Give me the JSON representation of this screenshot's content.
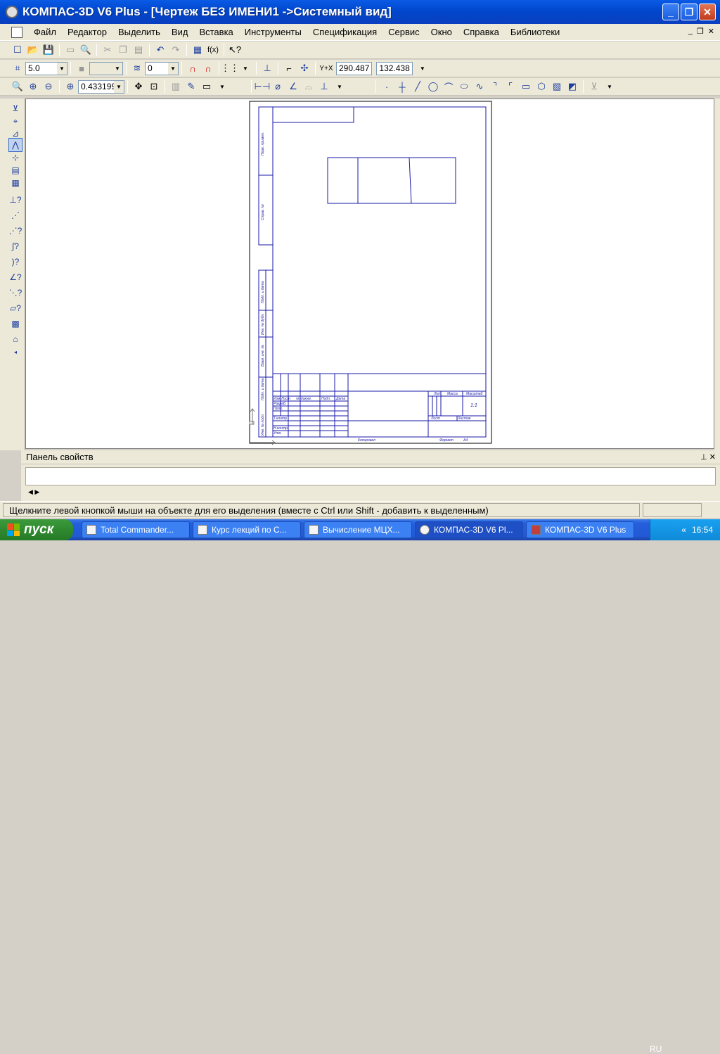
{
  "window": {
    "title": "КОМПАС-3D V6 Plus - [Чертеж БЕЗ ИМЕНИ1 ->Системный вид]"
  },
  "menu": [
    "Файл",
    "Редактор",
    "Выделить",
    "Вид",
    "Вставка",
    "Инструменты",
    "Спецификация",
    "Сервис",
    "Окно",
    "Справка",
    "Библиотеки"
  ],
  "toolbar": {
    "step_value": "5.0",
    "layer_value": "0",
    "coord_x": "290.487",
    "coord_y": "132.438",
    "zoom_value": "0.433199"
  },
  "drawing": {
    "margin_labels": [
      "Перв. примен.",
      "Справ. №",
      "Подп. и дата",
      "Инв. № дубл.",
      "Взам. инв. №",
      "Подп. и дата",
      "Инв. № подл."
    ],
    "titleblock": {
      "change_headers": [
        "Изм.",
        "Лист",
        "№ докум.",
        "Подп.",
        "Дата"
      ],
      "roles": [
        "Разраб.",
        "Пров.",
        "Т.контр.",
        "Н.контр.",
        "Утв."
      ],
      "lit": "Лит.",
      "mass": "Масса",
      "scale": "Масштаб",
      "scale_value": "1:1",
      "sheet": "Лист",
      "sheets": "Листов",
      "copied": "Копировал",
      "format": "Формат",
      "format_value": "A4"
    }
  },
  "properties_panel": {
    "title": "Панель свойств"
  },
  "status": {
    "message": "Щелкните левой кнопкой мыши на объекте для его выделения (вместе с Ctrl или Shift - добавить к выделенным)"
  },
  "taskbar": {
    "start_label": "пуск",
    "tasks": [
      "Total Commander...",
      "Курс лекций по С...",
      "Вычисление МЦХ...",
      "КОМПАС-3D V6 Pl...",
      "КОМПАС-3D V6 Plus"
    ],
    "lang": "RU",
    "clock": "16:54"
  }
}
